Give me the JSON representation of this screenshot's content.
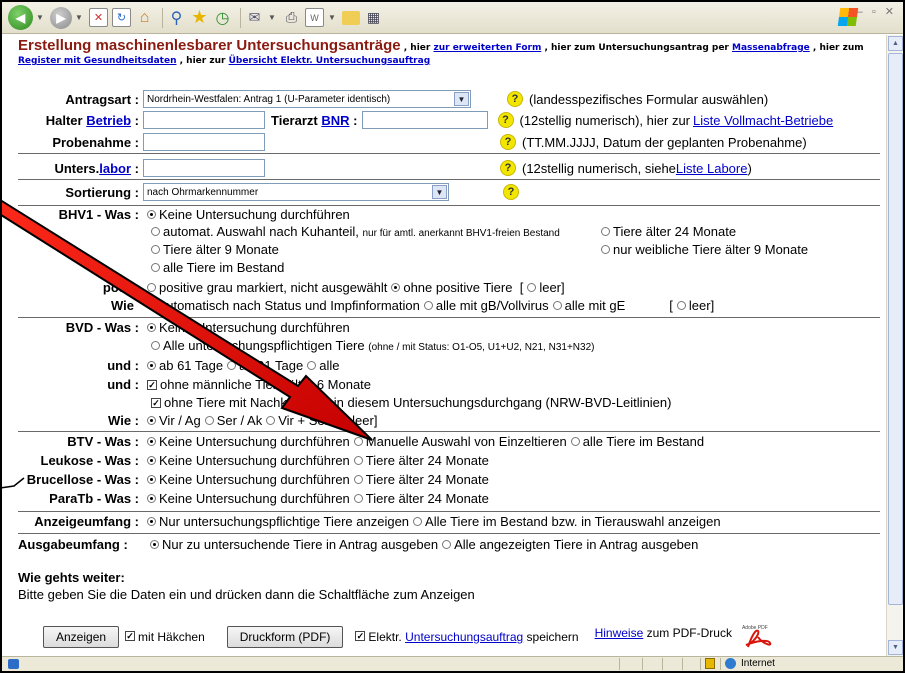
{
  "header": {
    "title": "Erstellung maschinenlesbarer Untersuchungsanträge",
    "t1": " , hier ",
    "l1": "zur erweiterten Form",
    "t2": " , hier zum Untersuchungsantrag per ",
    "l2": "Massenabfrage",
    "t3": " , hier zum ",
    "l3": "Register mit Gesundheitsdaten",
    "t4": " , hier zur ",
    "l4": "Übersicht Elektr. Untersuchungsauftrag"
  },
  "antragsart": {
    "label": "Antragsart :",
    "value": "Nordrhein-Westfalen: Antrag 1 (U-Parameter identisch)",
    "hint": "(landesspezifisches Formular auswählen)"
  },
  "halter": {
    "label": "Halter",
    "link": "Betrieb",
    "colon": ":",
    "tierarzt": "Tierarzt",
    "bnr": "BNR",
    "hint_pre": "(12stellig numerisch), hier zur ",
    "hint_link": "Liste Vollmacht-Betriebe"
  },
  "probenahme": {
    "label": "Probenahme :",
    "hint": "(TT.MM.JJJJ, Datum der geplanten Probenahme)"
  },
  "labor": {
    "label": "Unters.",
    "link": "labor",
    "colon": " :",
    "hint_pre": "(12stellig numerisch, siehe ",
    "hint_link": "Liste Labore",
    "hint_post": ")"
  },
  "sortierung": {
    "label": "Sortierung :",
    "value": "nach Ohrmarkennummer"
  },
  "bhv1": {
    "label": "BHV1 - Was :",
    "o1": "Keine Untersuchung durchführen",
    "o2": "automat. Auswahl nach Kuhanteil,",
    "o2small": "nur für amtl. anerkannt BHV1-freien Bestand",
    "o3": "Tiere älter 24 Monate",
    "o4": "Tiere älter 9 Monate",
    "o5": "nur weibliche Tiere älter 9 Monate",
    "o6": "alle Tiere im Bestand",
    "pos_label": "pos",
    "pos1": "positive grau markiert, nicht ausgewählt",
    "pos2": "ohne positive Tiere",
    "leer1": "[",
    "leer2": "leer]",
    "wie_label": "Wie",
    "wie1": "automatisch nach Status und Impfinformation",
    "wie2": "alle mit gB/Vollvirus",
    "wie3": "alle mit gE",
    "wie_leer1": "[",
    "wie_leer2": "leer]"
  },
  "bvd": {
    "label": "BVD - Was :",
    "o1": "Keine Untersuchung durchführen",
    "o2": "Alle untersuchungspflichtigen Tiere",
    "o2small": "(ohne / mit Status: O1-O5, U1+U2, N21, N31+N32)",
    "und1_label": "und :",
    "und1a": "ab 61 Tage",
    "und1b": "ab 91 Tage",
    "und1c": "alle",
    "und2_label": "und :",
    "und2a": "ohne männliche Tiere älter 6 Monate",
    "und2b": "ohne Tiere mit Nachkommen in diesem Untersuchungsdurchgang (NRW-BVD-Leitlinien)",
    "wie_label": "Wie :",
    "wie1": "Vir / Ag",
    "wie2": "Ser / Ak",
    "wie3": "Vir + Ser",
    "wie4": "[",
    "wie5": "leer]"
  },
  "btv": {
    "label": "BTV - Was :",
    "o1": "Keine Untersuchung durchführen",
    "o2": "Manuelle Auswahl von Einzeltieren",
    "o3": "alle Tiere im Bestand"
  },
  "leukose": {
    "label": "Leukose - Was :",
    "o1": "Keine Untersuchung durchführen",
    "o2": "Tiere älter 24 Monate"
  },
  "brucellose": {
    "label": "Brucellose - Was :",
    "o1": "Keine Untersuchung durchführen",
    "o2": "Tiere älter 24 Monate"
  },
  "paratb": {
    "label": "ParaTb - Was :",
    "o1": "Keine Untersuchung durchführen",
    "o2": "Tiere älter 24 Monate"
  },
  "anzeige": {
    "label": "Anzeigeumfang :",
    "o1": "Nur untersuchungspflichtige Tiere anzeigen",
    "o2": "Alle Tiere im Bestand bzw. in Tierauswahl anzeigen"
  },
  "ausgabe": {
    "label": "Ausgabeumfang :",
    "o1": "Nur zu untersuchende Tiere in Antrag ausgeben",
    "o2": "Alle angezeigten Tiere in Antrag ausgeben"
  },
  "weiter": {
    "title": "Wie gehts weiter:",
    "text": "Bitte geben Sie die Daten ein und drücken dann die Schaltfläche zum Anzeigen"
  },
  "actions": {
    "anzeigen": "Anzeigen",
    "haekchen": "mit Häkchen",
    "druckform": "Druckform (PDF)",
    "elektr": "Elektr.",
    "auftrag_link": "Untersuchungsauftrag",
    "speichern": "speichern",
    "hinweise_link": "Hinweise",
    "pdf_druck": "zum PDF-Druck",
    "pdf_icon_text": "Adobe PDF"
  },
  "status": {
    "zone": "Internet"
  },
  "colors": {
    "title": "#8b1a10",
    "link": "#0000cc",
    "arrow": "#e00000",
    "help": "#f2e600"
  }
}
